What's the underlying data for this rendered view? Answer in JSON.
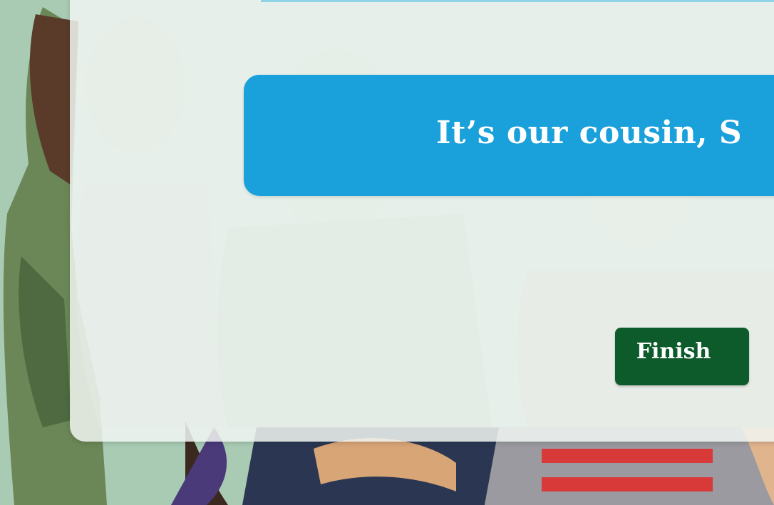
{
  "speech_banner": {
    "text": "It’s our cousin, S"
  },
  "finish_button": {
    "label": "Finish"
  },
  "colors": {
    "background": "#a9cbb4",
    "banner": "#1aa0da",
    "button": "#0d5b2a",
    "panel_overlay": "#f0f5f1"
  }
}
